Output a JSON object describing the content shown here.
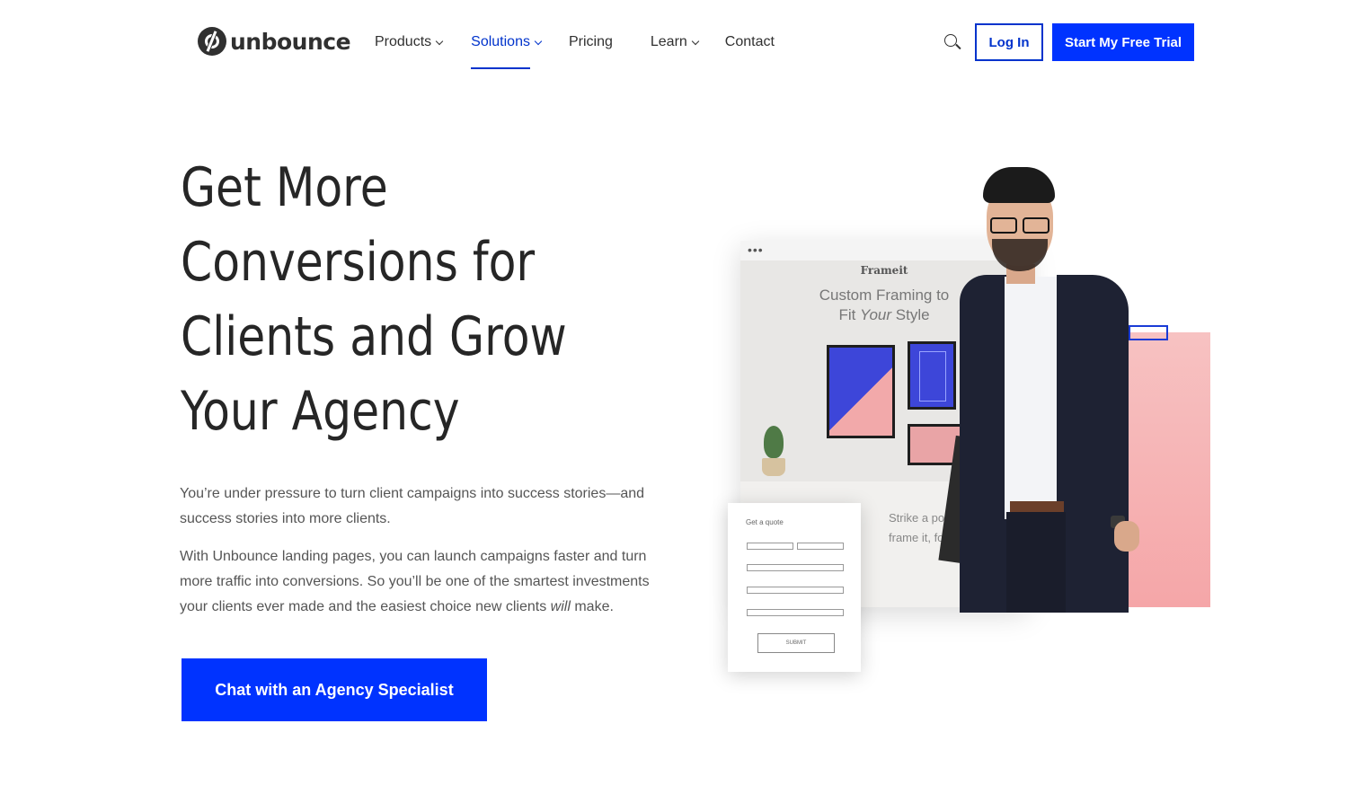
{
  "brand": {
    "name": "unbounce"
  },
  "nav": {
    "items": [
      {
        "label": "Products",
        "dropdown": true,
        "active": false
      },
      {
        "label": "Solutions",
        "dropdown": true,
        "active": true
      },
      {
        "label": "Pricing",
        "dropdown": false,
        "active": false
      },
      {
        "label": "Learn",
        "dropdown": true,
        "active": false
      },
      {
        "label": "Contact",
        "dropdown": false,
        "active": false
      }
    ],
    "search_icon": "search-icon",
    "login_label": "Log In",
    "trial_label": "Start My Free Trial"
  },
  "hero": {
    "title_lines": [
      "Get More",
      "Conversions for",
      "Clients and Grow",
      "Your Agency"
    ],
    "para1": "You’re under pressure to turn client campaigns into success stories—and success stories into more clients.",
    "para2_start": "With Unbounce landing pages, you can launch campaigns faster and turn more traffic into conversions. So you’ll be one of the smartest investments your clients ever made and the easiest choice new clients ",
    "para2_em": "will",
    "para2_end": " make.",
    "cta_label": "Chat with an Agency Specialist"
  },
  "mockup": {
    "brand": "Frameit",
    "headline_line1": "Custom Framing to",
    "headline_line2_pre": "Fit ",
    "headline_line2_em": "Your",
    "headline_line2_post": " Style",
    "lower_line1": "Strike a pos",
    "lower_line2": "frame it, for",
    "form_title": "Get a quote",
    "form_submit": "SUBMIT"
  },
  "colors": {
    "primary": "#0033ff",
    "nav_active": "#0033cc",
    "text": "#303030",
    "pink": "#f5a6a8"
  }
}
